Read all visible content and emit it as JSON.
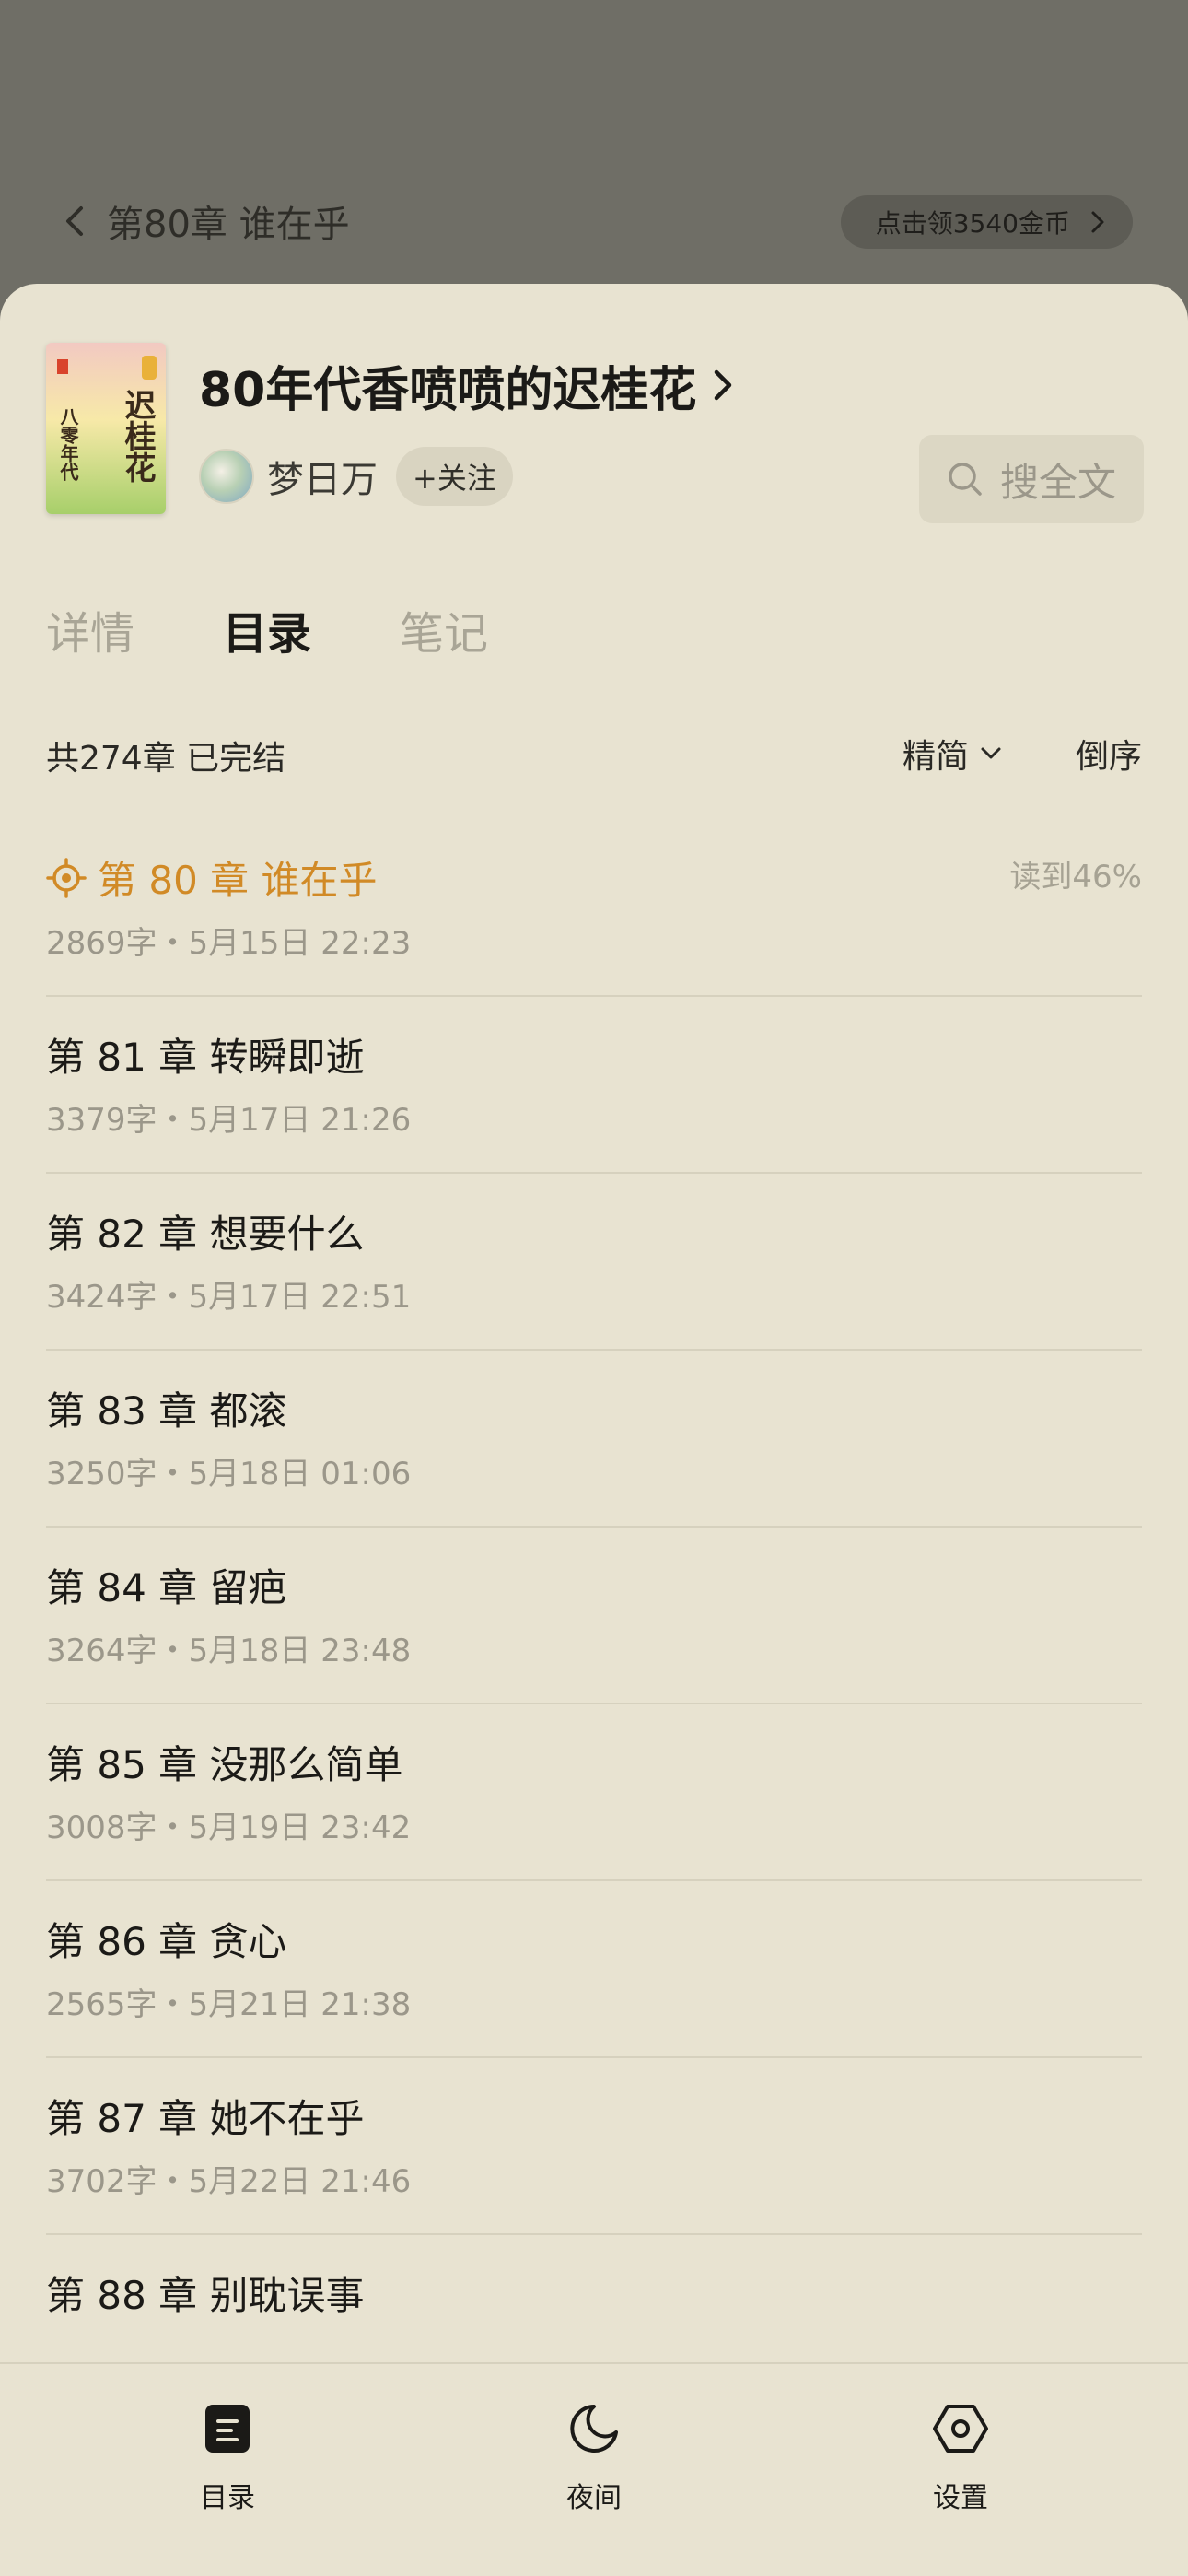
{
  "reader": {
    "back_chapter_title": "第80章 谁在乎",
    "coin_pill_label": "点击领3540金币"
  },
  "book": {
    "title": "80年代香喷喷的迟桂花",
    "cover_text_title": "迟桂花",
    "cover_text_sub": "八零年代",
    "author": "梦日万",
    "follow_label": "+关注",
    "search_label": "搜全文"
  },
  "tabs": [
    {
      "label": "详情"
    },
    {
      "label": "目录"
    },
    {
      "label": "笔记"
    }
  ],
  "summary": {
    "chapter_count": "共274章 已完结",
    "variant": "精简",
    "order": "倒序"
  },
  "chapters": [
    {
      "title": "第 80 章  谁在乎",
      "meta": "2869字・5月15日 22:23",
      "progress": "读到46%",
      "current": true
    },
    {
      "title": "第 81 章  转瞬即逝",
      "meta": "3379字・5月17日 21:26"
    },
    {
      "title": "第 82 章  想要什么",
      "meta": "3424字・5月17日 22:51"
    },
    {
      "title": "第 83 章  都滚",
      "meta": "3250字・5月18日 01:06"
    },
    {
      "title": "第 84 章  留疤",
      "meta": "3264字・5月18日 23:48"
    },
    {
      "title": "第 85 章  没那么简单",
      "meta": "3008字・5月19日 23:42"
    },
    {
      "title": "第 86 章  贪心",
      "meta": "2565字・5月21日 21:38"
    },
    {
      "title": "第 87 章  她不在乎",
      "meta": "3702字・5月22日 21:46"
    },
    {
      "title": "第 88 章  别耽误事",
      "meta": ""
    }
  ],
  "bottom_nav": [
    {
      "label": "目录",
      "icon": "catalog-icon"
    },
    {
      "label": "夜间",
      "icon": "moon-icon"
    },
    {
      "label": "设置",
      "icon": "settings-hex-icon"
    }
  ],
  "colors": {
    "sheet_bg": "#e8e3d1",
    "accent_current": "#d18a26",
    "backdrop": "#6f6e66"
  }
}
